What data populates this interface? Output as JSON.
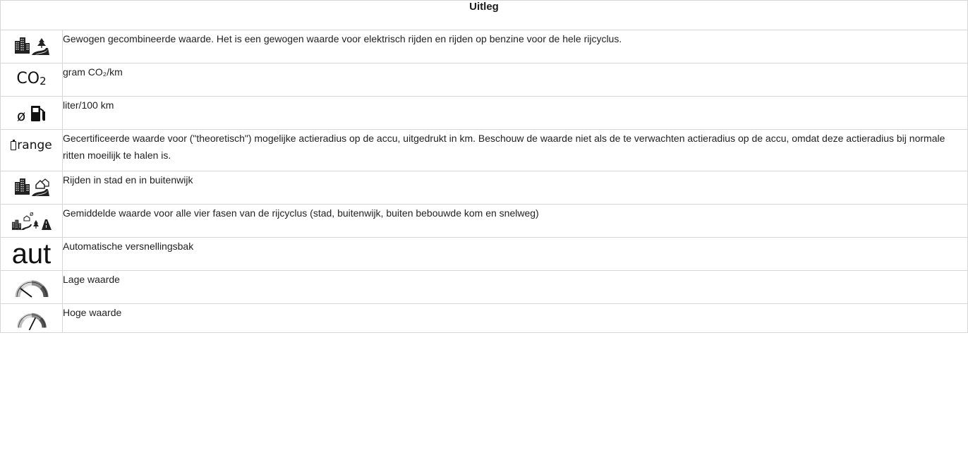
{
  "header": {
    "title": "Uitleg"
  },
  "rows": [
    {
      "icon": "city-and-country-road-icon",
      "text": "Gewogen gecombineerde waarde. Het is een gewogen waarde voor elektrisch rijden en rijden op benzine voor de hele rijcyclus."
    },
    {
      "icon": "co2-icon",
      "icon_text": "CO₂",
      "text": "gram CO₂/km"
    },
    {
      "icon": "average-fuel-pump-icon",
      "icon_text": "ø",
      "text": "liter/100 km"
    },
    {
      "icon": "battery-range-icon",
      "icon_text": "range",
      "text": "Gecertificeerde waarde voor (\"theoretisch\") mogelijke actieradius op de accu, uitgedrukt in km. Beschouw de waarde niet als de te verwachten actieradius op de accu, omdat deze actieradius bij normale ritten moeilijk te halen is."
    },
    {
      "icon": "city-and-suburb-icon",
      "text": "Rijden in stad en in buitenwijk"
    },
    {
      "icon": "average-all-phases-icon",
      "icon_text": "ø",
      "text": "Gemiddelde waarde voor alle vier fasen van de rijcyclus (stad, buitenwijk, buiten bebouwde kom en snelweg)"
    },
    {
      "icon": "automatic-transmission-icon",
      "icon_text": "aut",
      "text": "Automatische versnellingsbak"
    },
    {
      "icon": "low-value-gauge-icon",
      "text": "Lage waarde"
    },
    {
      "icon": "high-value-gauge-icon",
      "text": "Hoge waarde"
    }
  ],
  "colors": {
    "border": "#d6d6d6",
    "text": "#222222",
    "gauge_dark": "#555555",
    "gauge_mid": "#8c8c8c"
  }
}
